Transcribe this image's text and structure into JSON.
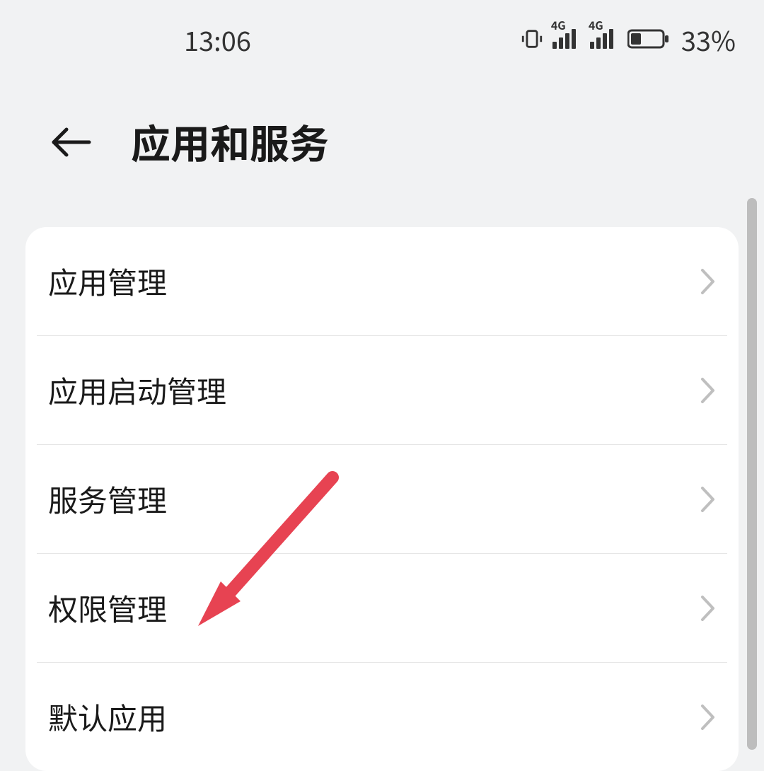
{
  "status": {
    "time": "13:06",
    "battery_percent": "33%"
  },
  "header": {
    "title": "应用和服务"
  },
  "list": {
    "items": [
      {
        "label": "应用管理"
      },
      {
        "label": "应用启动管理"
      },
      {
        "label": "服务管理"
      },
      {
        "label": "权限管理"
      },
      {
        "label": "默认应用"
      }
    ]
  }
}
